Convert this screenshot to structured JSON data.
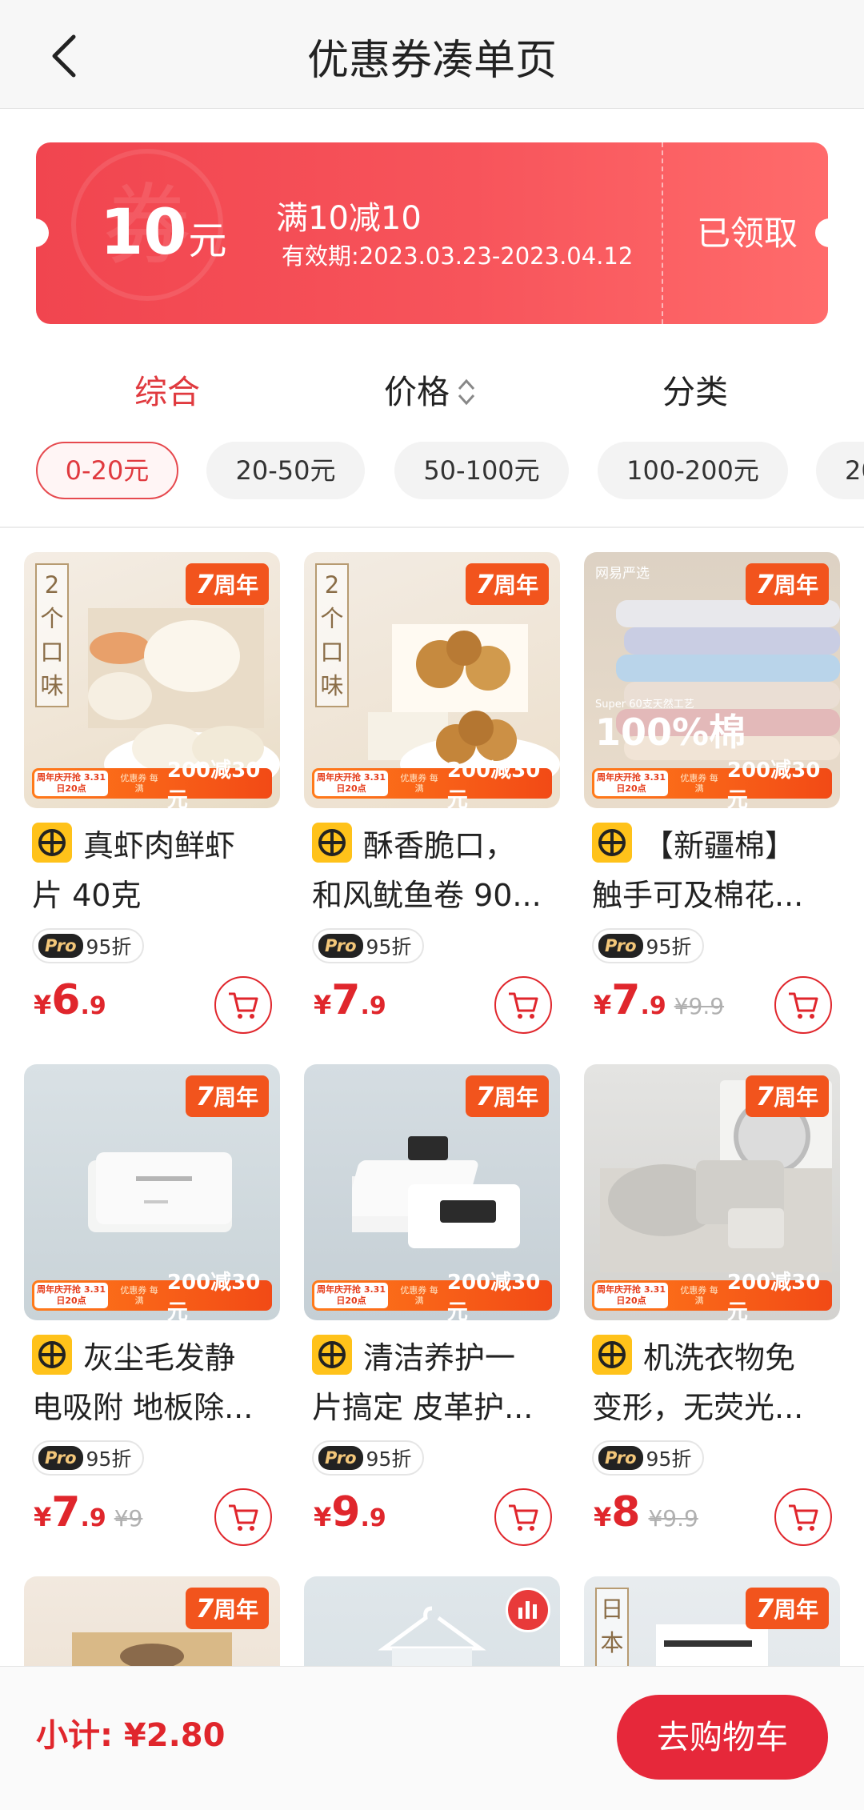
{
  "header": {
    "title": "优惠券凑单页"
  },
  "coupon": {
    "watermark": "券",
    "amount": "10",
    "unit": "元",
    "condition": "满10减10",
    "validity": "有效期:2023.03.23-2023.04.12",
    "status": "已领取",
    "colors": {
      "start": "#f1454f",
      "end": "#ff6b6b"
    }
  },
  "sort": {
    "tabs": [
      "综合",
      "价格",
      "分类"
    ],
    "active": "综合"
  },
  "price_filters": {
    "chips": [
      "0-20元",
      "20-50元",
      "50-100元",
      "100-200元",
      "20"
    ],
    "active": "0-20元"
  },
  "badges": {
    "anniversary": "周年",
    "anniversary_digit": "7",
    "vertical_tag": "2个口味",
    "promo_left": "周年庆开抢 3.31日20点",
    "promo_mid": "优惠券 每满",
    "promo_main": "200减30元"
  },
  "products": [
    {
      "title_line1": "真虾肉鲜虾",
      "title_line2": "片 40克",
      "discount": "95折",
      "price_yen": "¥",
      "price_int": "6",
      "price_dec": ".9",
      "orig_price": ""
    },
    {
      "title_line1": "酥香脆口，",
      "title_line2": "和风鱿鱼卷 90...",
      "discount": "95折",
      "price_yen": "¥",
      "price_int": "7",
      "price_dec": ".9",
      "orig_price": ""
    },
    {
      "title_line1": "【新疆棉】",
      "title_line2": "触手可及棉花...",
      "discount": "95折",
      "price_yen": "¥",
      "price_int": "7",
      "price_dec": ".9",
      "orig_price": "¥9.9"
    },
    {
      "title_line1": "灰尘毛发静",
      "title_line2": "电吸附 地板除...",
      "discount": "95折",
      "price_yen": "¥",
      "price_int": "7",
      "price_dec": ".9",
      "orig_price": "¥9"
    },
    {
      "title_line1": "清洁养护一",
      "title_line2": "片搞定 皮革护...",
      "discount": "95折",
      "price_yen": "¥",
      "price_int": "9",
      "price_dec": ".9",
      "orig_price": ""
    },
    {
      "title_line1": "机洗衣物免",
      "title_line2": "变形，无荧光...",
      "discount": "95折",
      "price_yen": "¥",
      "price_int": "8",
      "price_dec": "",
      "orig_price": "¥9.9"
    }
  ],
  "image_texts": {
    "p3_brand": "网易严选",
    "p3_sub": "Super 60支天然工艺",
    "p3_big": "100%棉",
    "p9_tag": "日本"
  },
  "pro_label": "Pro",
  "footer": {
    "subtotal": "小计: ¥2.80",
    "go_cart": "去购物车"
  },
  "accent_color": "#e0262c"
}
